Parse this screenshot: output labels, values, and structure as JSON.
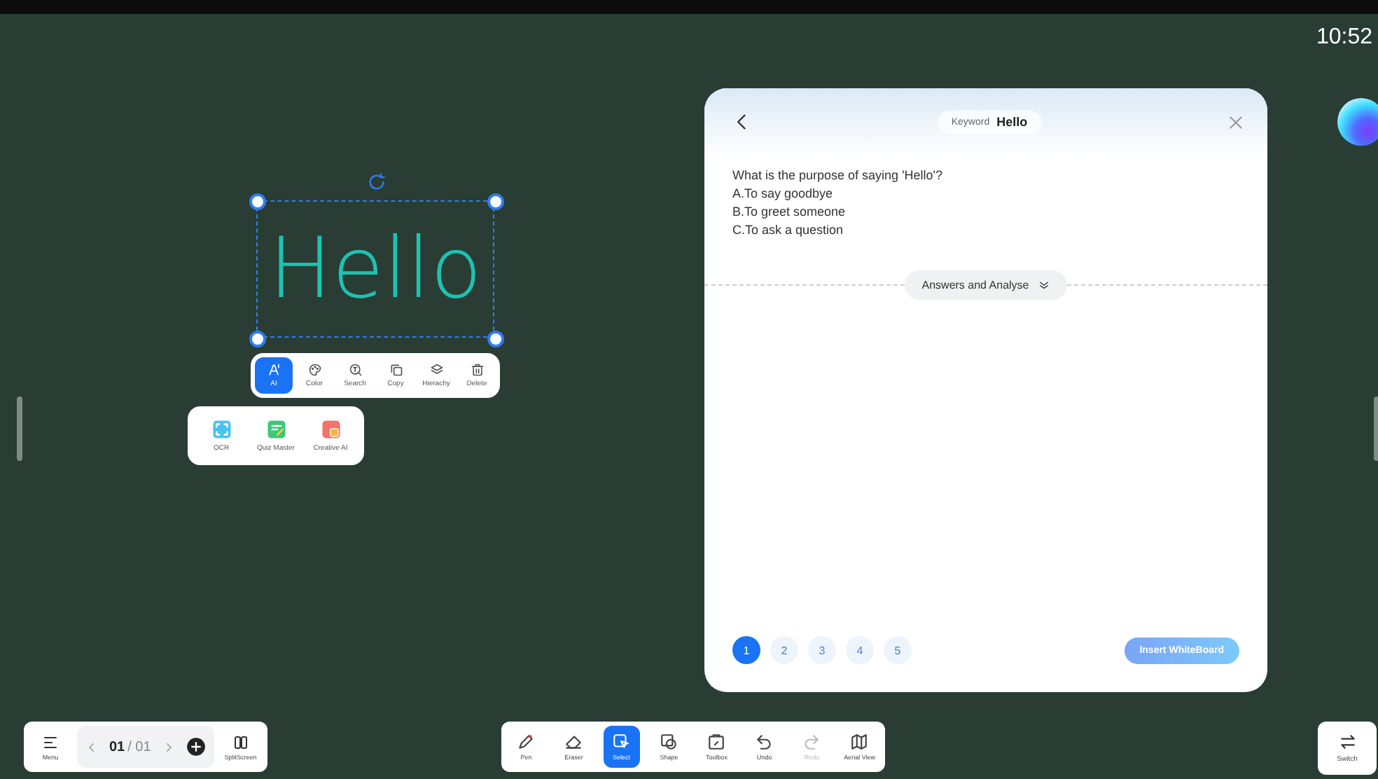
{
  "status_bar": {
    "time": "10:52"
  },
  "canvas": {
    "ink_text": "Hello",
    "selection_actions": [
      {
        "label": "AI",
        "selected": true
      },
      {
        "label": "Color",
        "selected": false
      },
      {
        "label": "Search",
        "selected": false
      },
      {
        "label": "Copy",
        "selected": false
      },
      {
        "label": "Hierachy",
        "selected": false
      },
      {
        "label": "Delete",
        "selected": false
      }
    ],
    "ai_menu": [
      {
        "label": "OCR"
      },
      {
        "label": "Quiz Master"
      },
      {
        "label": "Creative AI"
      }
    ]
  },
  "quiz_panel": {
    "keyword_label": "Keyword",
    "keyword": "Hello",
    "question": "What is the purpose of saying 'Hello'?",
    "options": [
      "A.To say goodbye",
      "B.To greet someone",
      "C.To ask a question"
    ],
    "answers_button": "Answers and Analyse",
    "pages": [
      {
        "label": "1",
        "selected": true
      },
      {
        "label": "2",
        "selected": false
      },
      {
        "label": "3",
        "selected": false
      },
      {
        "label": "4",
        "selected": false
      },
      {
        "label": "5",
        "selected": false
      }
    ],
    "insert_button": "Insert WhiteBoard"
  },
  "page_bar": {
    "menu": "Menu",
    "page_current": "01",
    "page_total": "/ 01",
    "split_screen": "SplitScreen"
  },
  "toolbar": [
    {
      "label": "Pen",
      "selected": false,
      "disabled": false
    },
    {
      "label": "Eraser",
      "selected": false,
      "disabled": false
    },
    {
      "label": "Select",
      "selected": true,
      "disabled": false
    },
    {
      "label": "Shape",
      "selected": false,
      "disabled": false
    },
    {
      "label": "Toolbox",
      "selected": false,
      "disabled": false
    },
    {
      "label": "Undo",
      "selected": false,
      "disabled": false
    },
    {
      "label": "Redo",
      "selected": false,
      "disabled": true
    },
    {
      "label": "Aerial View",
      "selected": false,
      "disabled": false
    }
  ],
  "switch_button": "Switch"
}
